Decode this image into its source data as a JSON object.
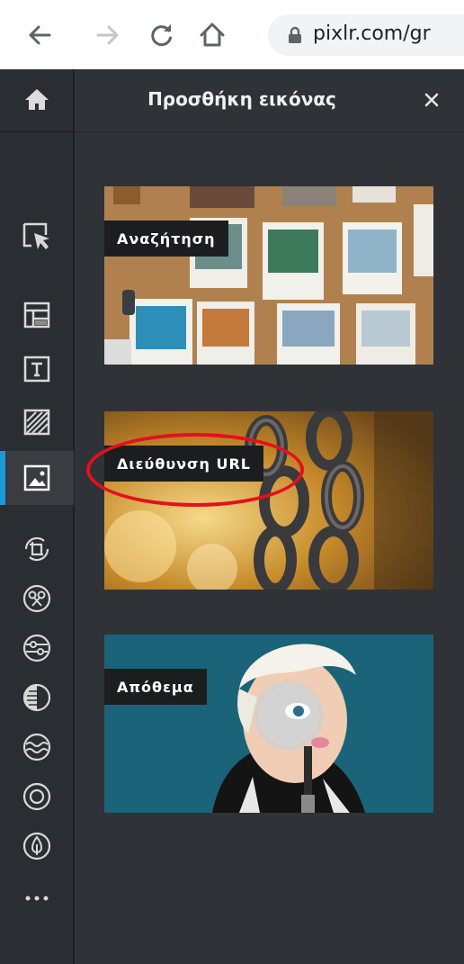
{
  "browser": {
    "url": "pixlr.com/gr",
    "icons": [
      "back-arrow-icon",
      "forward-arrow-icon",
      "reload-icon",
      "home-icon",
      "lock-icon"
    ]
  },
  "toolbar": {
    "items": [
      {
        "name": "home-icon"
      },
      {
        "name": "arrange-select-icon"
      },
      {
        "name": "layout-template-icon"
      },
      {
        "name": "text-tool-icon"
      },
      {
        "name": "pattern-fill-icon"
      },
      {
        "name": "add-image-icon",
        "active": true
      },
      {
        "name": "crop-icon"
      },
      {
        "name": "cutout-icon"
      },
      {
        "name": "adjust-icon"
      },
      {
        "name": "filter-icon"
      },
      {
        "name": "liquify-icon"
      },
      {
        "name": "focus-icon"
      },
      {
        "name": "draw-icon"
      },
      {
        "name": "more-icon"
      }
    ]
  },
  "panel": {
    "title": "Προσθήκη εικόνας",
    "close_icon": "close-icon",
    "cards": [
      {
        "label": "Αναζήτηση"
      },
      {
        "label": "Διεύθυνση URL",
        "highlighted": true
      },
      {
        "label": "Απόθεμα"
      }
    ]
  },
  "colors": {
    "accent": "#1a9ad8",
    "highlight": "#e5101d",
    "panel_bg": "#2f3237",
    "toolbar_bg": "#2a2d31"
  }
}
